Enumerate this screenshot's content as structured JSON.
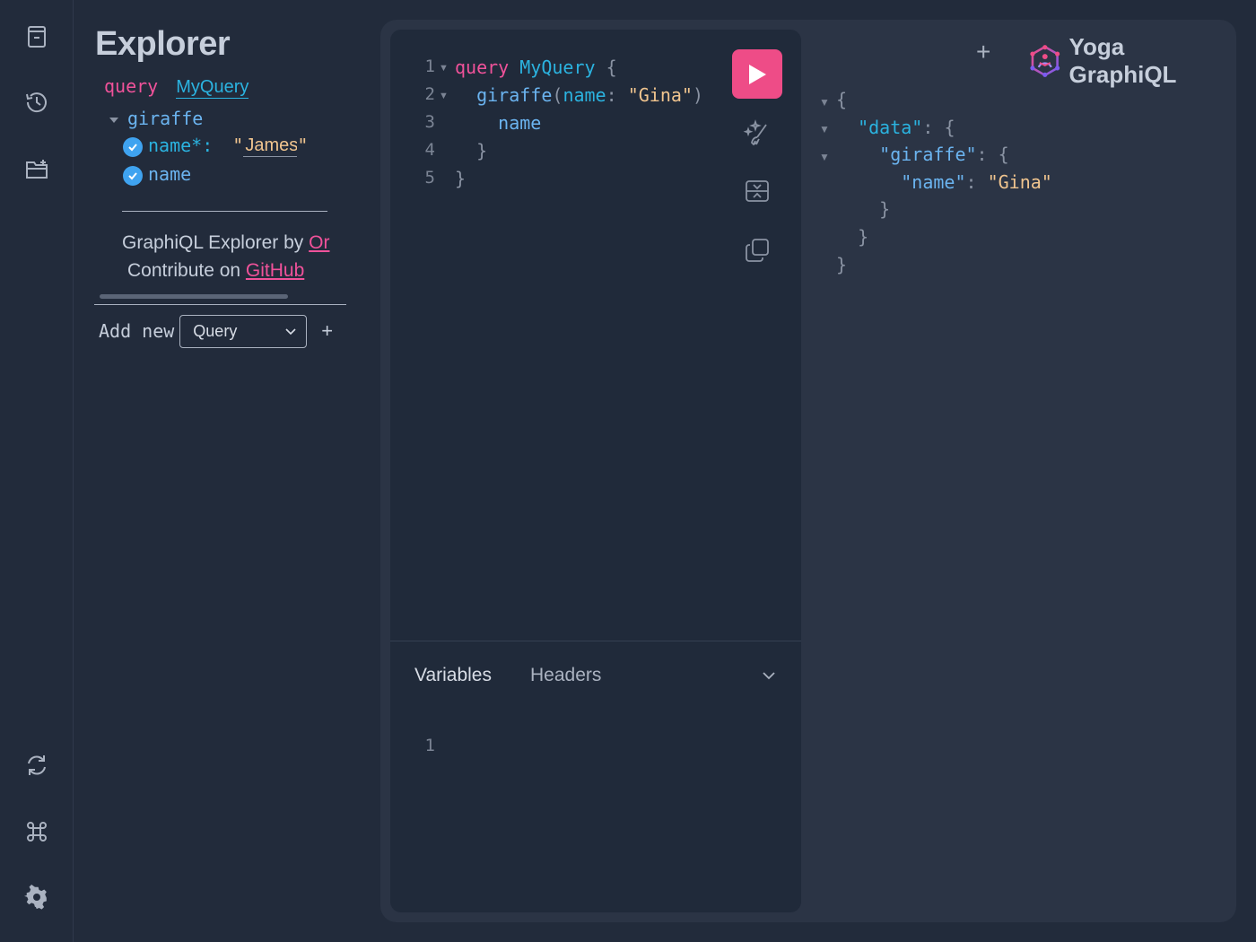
{
  "sidebar": {
    "icons": [
      "docs-icon",
      "history-icon",
      "collections-icon",
      "refetch-schema-icon",
      "shortcuts-icon",
      "settings-icon"
    ]
  },
  "explorer": {
    "title": "Explorer",
    "operation_keyword": "query",
    "operation_name": "MyQuery",
    "field": "giraffe",
    "arg_label": "name*:",
    "arg_quote_open": "\"",
    "arg_value": "James",
    "arg_quote_close": "\"",
    "subfield": "name",
    "credit_prefix": "GraphiQL Explorer by ",
    "credit_link": "Or",
    "contribute_prefix": "Contribute on ",
    "contribute_link": "GitHub",
    "add_new_label": "Add new",
    "add_new_selected": "Query",
    "add_new_plus": "+"
  },
  "editor": {
    "line_numbers": [
      "1",
      "2",
      "3",
      "4",
      "5"
    ],
    "lines": {
      "l1_kw": "query",
      "l1_name": "MyQuery",
      "l1_brace": "{",
      "l2_field": "giraffe",
      "l2_paren_open": "(",
      "l2_arg": "name",
      "l2_colon": ":",
      "l2_value": "\"Gina\"",
      "l2_paren_close": ")",
      "l3_field": "name",
      "l4_brace": "}",
      "l5_brace": "}"
    },
    "tabs": {
      "variables": "Variables",
      "headers": "Headers"
    },
    "variables_line_number": "1"
  },
  "result": {
    "brand": "Yoga GraphiQL",
    "new_tab": "+",
    "open_brace": "{",
    "data_key": "\"data\"",
    "giraffe_key": "\"giraffe\"",
    "name_key": "\"name\"",
    "name_value": "\"Gina\"",
    "colon": ":",
    "close_brace": "}"
  },
  "colors": {
    "accent_pink": "#ee4c87",
    "keyword": "#f0529a",
    "name": "#2bb3e0",
    "string": "#f1c58f",
    "background": "#222b3b"
  }
}
